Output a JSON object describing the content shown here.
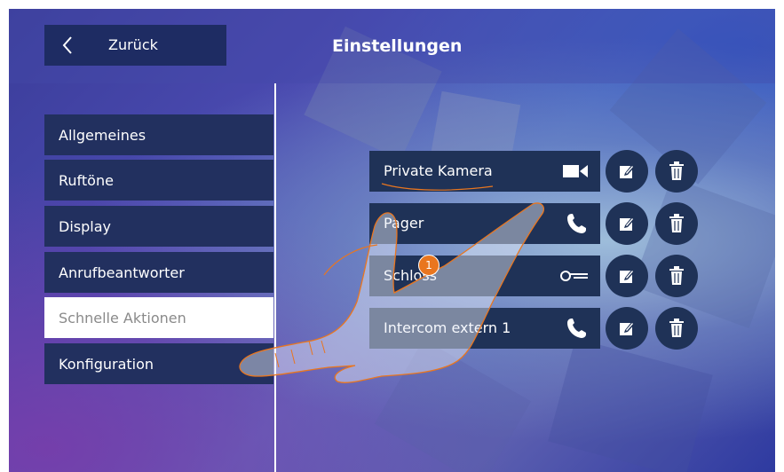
{
  "header": {
    "back_label": "Zurück",
    "title": "Einstellungen"
  },
  "menu": {
    "items": [
      {
        "label": "Allgemeines"
      },
      {
        "label": "Ruftöne"
      },
      {
        "label": "Display"
      },
      {
        "label": "Anrufbeantworter"
      },
      {
        "label": "Schnelle Aktionen",
        "active": true
      },
      {
        "label": "Konfiguration"
      }
    ]
  },
  "actions": {
    "items": [
      {
        "label": "Private Kamera",
        "icon": "video-camera-icon"
      },
      {
        "label": "Pager",
        "icon": "phone-icon"
      },
      {
        "label": "Schloss",
        "icon": "key-icon"
      },
      {
        "label": "Intercom extern 1",
        "icon": "phone-icon"
      }
    ],
    "edit_icon": "edit-icon",
    "delete_icon": "trash-icon"
  },
  "callout": {
    "number": "1"
  },
  "colors": {
    "button_bg": "#1f3257",
    "menu_bg": "#22305f",
    "active_bg": "#ffffff",
    "active_text": "#8a8a8a",
    "badge": "#e9761f",
    "hand_outline": "#e9761f"
  }
}
